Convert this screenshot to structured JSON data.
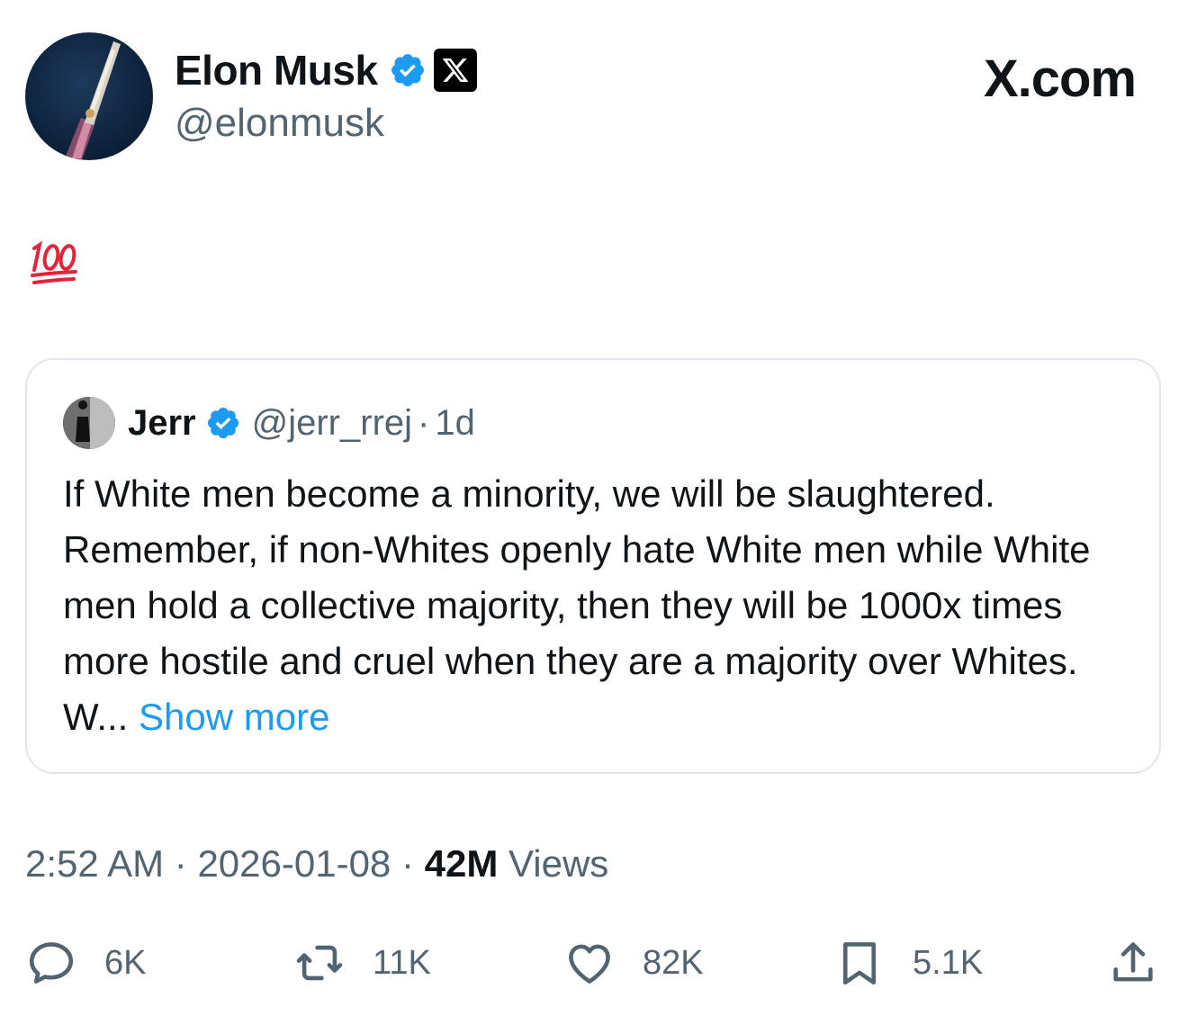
{
  "author": {
    "display_name": "Elon Musk",
    "handle": "@elonmusk",
    "verified_color": "#1d9bf0"
  },
  "brand": {
    "site": "X.com"
  },
  "post": {
    "text": "💯"
  },
  "quoted_post": {
    "display_name": "Jerr",
    "handle": "@jerr_rrej",
    "separator": "·",
    "age": "1d",
    "text": "If White men become a minority, we will be slaughtered. Remember, if non-Whites openly hate White men while White men hold a collective majority, then they will be 1000x times more hostile and cruel when they are a majority over Whites. W...",
    "show_more": "Show more"
  },
  "meta": {
    "time": "2:52 AM",
    "separator": "·",
    "date": "2026-01-08",
    "views_count": "42M",
    "views_label": "Views"
  },
  "actions": {
    "replies": "6K",
    "reposts": "11K",
    "likes": "82K",
    "bookmarks": "5.1K"
  },
  "icons": {
    "verified": "verified-badge-icon",
    "x_affiliate": "x-logo-icon",
    "reply": "reply-icon",
    "repost": "repost-icon",
    "like": "heart-icon",
    "bookmark": "bookmark-icon",
    "share": "share-icon"
  }
}
